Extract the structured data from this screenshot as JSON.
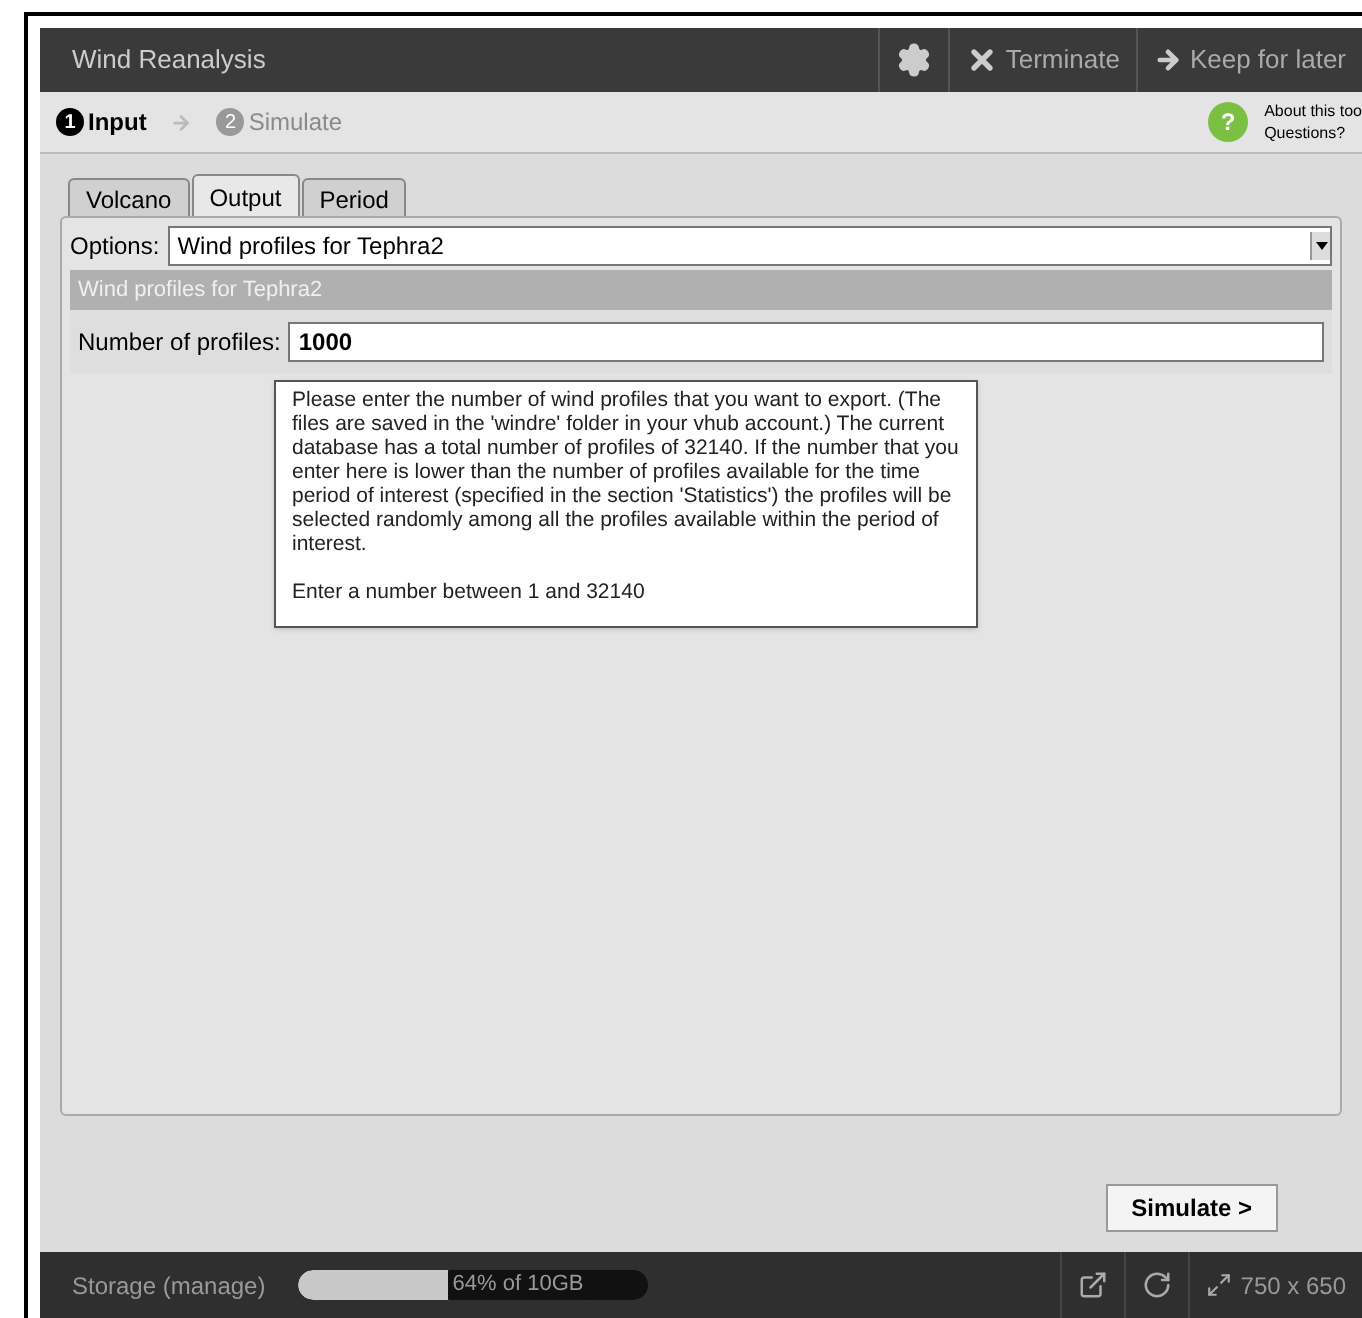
{
  "window": {
    "title": "Wind Reanalysis",
    "actions": [
      {
        "kind": "gear"
      },
      {
        "kind": "terminate",
        "label": "Terminate"
      },
      {
        "kind": "keep",
        "label": "Keep for later"
      }
    ]
  },
  "steps": [
    {
      "number": "1",
      "label": "Input",
      "selected": true
    },
    {
      "number": "2",
      "label": "Simulate",
      "selected": false
    }
  ],
  "help": {
    "icon": "?",
    "about": "About this too",
    "questions": "Questions?"
  },
  "tabs": [
    {
      "label": "Volcano",
      "selected": false
    },
    {
      "label": "Output",
      "selected": true
    },
    {
      "label": "Period",
      "selected": false
    }
  ],
  "options": {
    "label": "Options:",
    "value": "Wind profiles for Tephra2"
  },
  "section": {
    "title": "Wind profiles for Tephra2",
    "field_label": "Number of profiles:",
    "value": "1000"
  },
  "tooltip": {
    "paragraphs": [
      "Please enter the number of wind profiles that you want to export. (The files are saved in the 'windre' folder in your vhub account.) The current database has a total number of profiles of 32140. If the number that you enter here is lower than the number of profiles available for the time period of interest (specified in the section 'Statistics') the profiles will be selected randomly among all the profiles available within the period of interest.",
      "Enter a number between 1 and 32140"
    ]
  },
  "simulate_button": "Simulate >",
  "status_bar": {
    "storage_label": "Storage (manage)",
    "storage": {
      "level": 0.64,
      "reading": "64% of 10GB"
    },
    "size": "750 x 650"
  }
}
